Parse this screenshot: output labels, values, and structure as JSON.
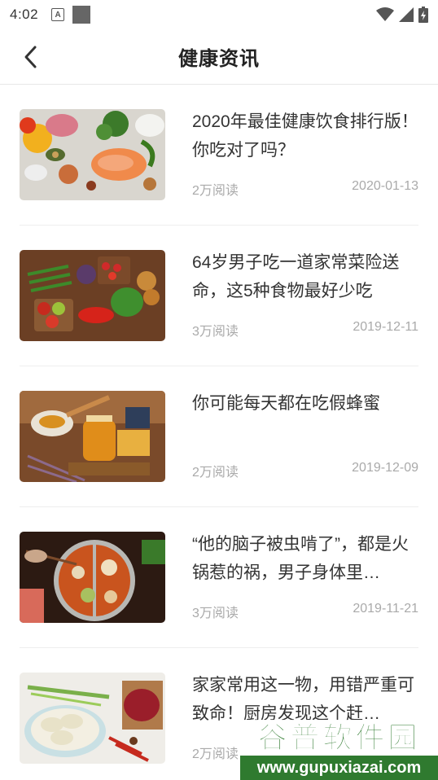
{
  "status_bar": {
    "time": "4:02",
    "icons": [
      "a-notification-icon",
      "square-notification-icon",
      "wifi-icon",
      "signal-icon",
      "battery-charging-icon"
    ]
  },
  "nav": {
    "back_icon": "back-chevron-icon",
    "title": "健康资讯"
  },
  "news": [
    {
      "title": "2020年最佳健康饮食排行版！你吃对了吗？",
      "reads": "2万阅读",
      "date": "2020-01-13",
      "thumb": "healthy-food-thumbnail"
    },
    {
      "title": "64岁男子吃一道家常菜险送命，这5种食物最好少吃",
      "reads": "3万阅读",
      "date": "2019-12-11",
      "thumb": "vegetables-thumbnail"
    },
    {
      "title": "你可能每天都在吃假蜂蜜",
      "reads": "2万阅读",
      "date": "2019-12-09",
      "thumb": "honey-thumbnail"
    },
    {
      "title": "“他的脑子被虫啃了”，都是火锅惹的祸，男子身体里…",
      "reads": "3万阅读",
      "date": "2019-11-21",
      "thumb": "hotpot-thumbnail"
    },
    {
      "title": "家家常用这一物，用错严重可致命！厨房发现这个赶…",
      "reads": "2万阅读",
      "date": "",
      "thumb": "dumplings-thumbnail"
    }
  ],
  "watermark": {
    "title": "谷普软件园",
    "url": "www.gupuxiazai.com"
  },
  "colors": {
    "text_primary": "#333333",
    "text_secondary": "#aaaaaa",
    "divider": "#eeeeee",
    "watermark_green": "#2f7a2f"
  }
}
